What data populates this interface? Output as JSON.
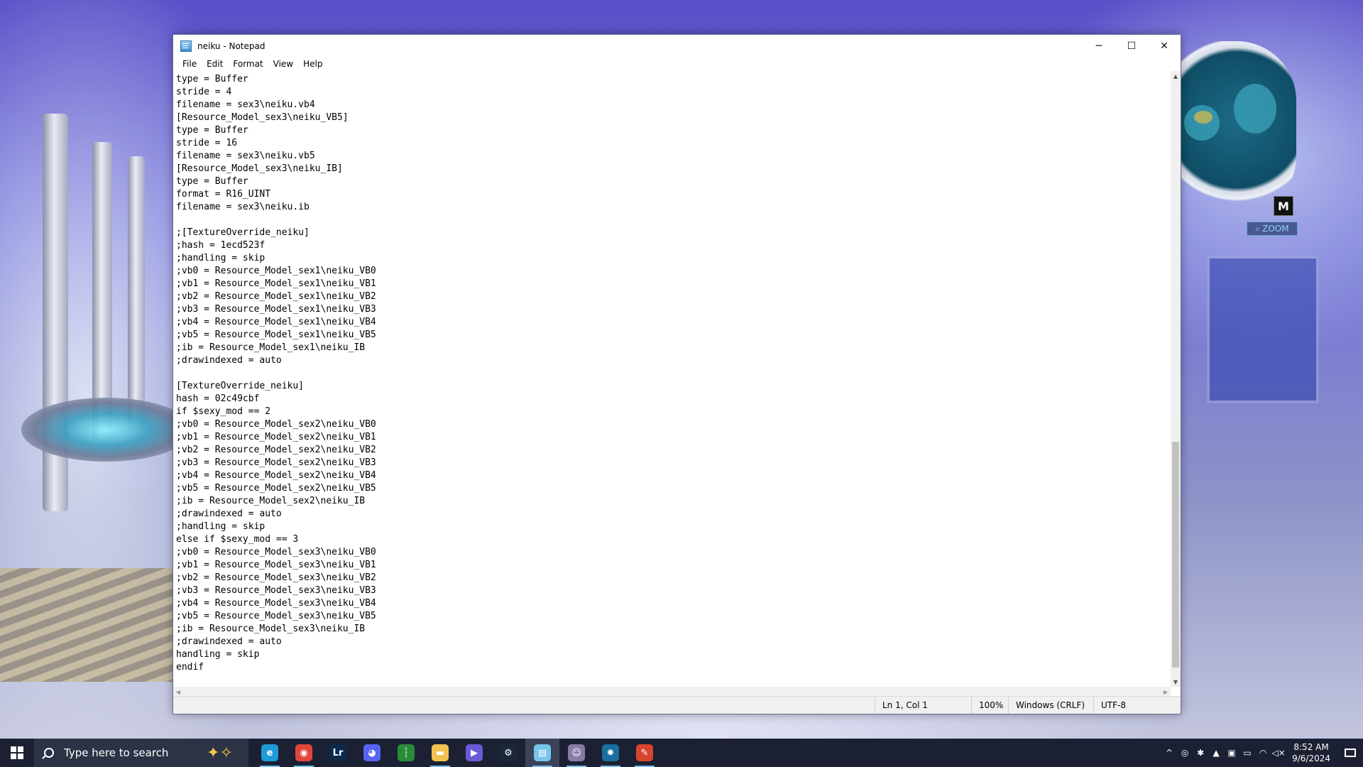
{
  "window": {
    "title": "neiku - Notepad",
    "controls": {
      "minimize": "─",
      "maximize": "☐",
      "close": "✕"
    }
  },
  "menu": [
    "File",
    "Edit",
    "Format",
    "View",
    "Help"
  ],
  "editor": {
    "lines": [
      "type = Buffer",
      "stride = 4",
      "filename = sex3\\neiku.vb4",
      "[Resource_Model_sex3\\neiku_VB5]",
      "type = Buffer",
      "stride = 16",
      "filename = sex3\\neiku.vb5",
      "[Resource_Model_sex3\\neiku_IB]",
      "type = Buffer",
      "format = R16_UINT",
      "filename = sex3\\neiku.ib",
      "",
      ";[TextureOverride_neiku]",
      ";hash = 1ecd523f",
      ";handling = skip",
      ";vb0 = Resource_Model_sex1\\neiku_VB0",
      ";vb1 = Resource_Model_sex1\\neiku_VB1",
      ";vb2 = Resource_Model_sex1\\neiku_VB2",
      ";vb3 = Resource_Model_sex1\\neiku_VB3",
      ";vb4 = Resource_Model_sex1\\neiku_VB4",
      ";vb5 = Resource_Model_sex1\\neiku_VB5",
      ";ib = Resource_Model_sex1\\neiku_IB",
      ";drawindexed = auto",
      "",
      "[TextureOverride_neiku]",
      "hash = 02c49cbf",
      "if $sexy_mod == 2",
      ";vb0 = Resource_Model_sex2\\neiku_VB0",
      ";vb1 = Resource_Model_sex2\\neiku_VB1",
      ";vb2 = Resource_Model_sex2\\neiku_VB2",
      ";vb3 = Resource_Model_sex2\\neiku_VB3",
      ";vb4 = Resource_Model_sex2\\neiku_VB4",
      ";vb5 = Resource_Model_sex2\\neiku_VB5",
      ";ib = Resource_Model_sex2\\neiku_IB",
      ";drawindexed = auto",
      ";handling = skip",
      "else if $sexy_mod == 3",
      ";vb0 = Resource_Model_sex3\\neiku_VB0",
      ";vb1 = Resource_Model_sex3\\neiku_VB1",
      ";vb2 = Resource_Model_sex3\\neiku_VB2",
      ";vb3 = Resource_Model_sex3\\neiku_VB3",
      ";vb4 = Resource_Model_sex3\\neiku_VB4",
      ";vb5 = Resource_Model_sex3\\neiku_VB5",
      ";ib = Resource_Model_sex3\\neiku_IB",
      ";drawindexed = auto",
      "handling = skip",
      "endif"
    ]
  },
  "status": {
    "position": "Ln 1, Col 1",
    "zoom": "100%",
    "line_ending": "Windows (CRLF)",
    "encoding": "UTF-8"
  },
  "minimap": {
    "key": "M",
    "zoom_label": "ZOOM"
  },
  "taskbar": {
    "search_placeholder": "Type here to search",
    "apps": [
      {
        "name": "edge-icon",
        "glyph": "e",
        "color": "#1f9bd8",
        "active": false,
        "running": true
      },
      {
        "name": "chrome-icon",
        "glyph": "◉",
        "color": "#e2463a",
        "active": false,
        "running": true
      },
      {
        "name": "lightroom-icon",
        "glyph": "Lr",
        "color": "#0c2a4a",
        "active": false,
        "running": false
      },
      {
        "name": "discord-icon",
        "glyph": "◕",
        "color": "#5865f2",
        "active": false,
        "running": false
      },
      {
        "name": "traffic-light-icon",
        "glyph": "┆",
        "color": "#2a8c3a",
        "active": false,
        "running": false
      },
      {
        "name": "file-explorer-icon",
        "glyph": "▬",
        "color": "#f2c14e",
        "active": false,
        "running": true
      },
      {
        "name": "video-editor-icon",
        "glyph": "▶",
        "color": "#6a5ad8",
        "active": false,
        "running": false
      },
      {
        "name": "steam-icon",
        "glyph": "⚙",
        "color": "#1b2838",
        "active": false,
        "running": false
      },
      {
        "name": "notepad-icon",
        "glyph": "▤",
        "color": "#76c5ea",
        "active": true,
        "running": true
      },
      {
        "name": "game-icon",
        "glyph": "☺",
        "color": "#8a7aa8",
        "active": false,
        "running": true
      },
      {
        "name": "gear-app-icon",
        "glyph": "✹",
        "color": "#1a6fa0",
        "active": false,
        "running": true
      },
      {
        "name": "paint-tool-icon",
        "glyph": "✎",
        "color": "#d8452f",
        "active": false,
        "running": true
      }
    ],
    "tray_icons": [
      "^",
      "◎",
      "✱",
      "▲",
      "▣",
      "▭",
      "◠",
      "◁×"
    ],
    "time": "8:52 AM",
    "date": "9/6/2024"
  }
}
